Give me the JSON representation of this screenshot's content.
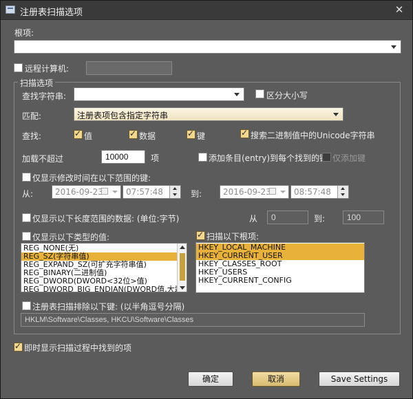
{
  "window": {
    "title": "注册表扫描选项",
    "close_glyph": "✕"
  },
  "root": {
    "label": "根项:",
    "value": ""
  },
  "remote": {
    "label": "远程计算机:",
    "checked": false,
    "value": ""
  },
  "scan_options": {
    "label": "扫描选项"
  },
  "find_string": {
    "label": "查找字符串:",
    "value": ""
  },
  "case_sensitive": {
    "label": "区分大小写",
    "checked": false
  },
  "match": {
    "label": "匹配:",
    "value": "注册表项包含指定字符串"
  },
  "search": {
    "label": "查找:",
    "values_label": "值",
    "values_checked": true,
    "data_label": "数据",
    "data_checked": true,
    "keys_label": "键",
    "keys_checked": true,
    "unicode_label": "搜索二进制值中的Unicode字符串",
    "unicode_checked": true
  },
  "load_limit": {
    "label": "加载不超过",
    "value": "10000",
    "unit": "项"
  },
  "add_entry": {
    "label": "添加条目(entry)到每个找到的键",
    "checked": false
  },
  "add_keys_only": {
    "label": "仅添加键",
    "checked": false
  },
  "modified_time": {
    "label": "仅显示修改时间在以下范围的键:",
    "checked": false,
    "from_label": "从:",
    "to_label": "到:",
    "from_date": "2016-09-23",
    "from_time": "07:57:48",
    "to_date": "2016-09-23",
    "to_time": "08:57:48"
  },
  "data_length": {
    "label": "仅显示以下长度范围的数据: (单位:字节)",
    "checked": false,
    "from_label": "从",
    "from_value": "0",
    "to_label": "到:",
    "to_value": "100"
  },
  "value_types": {
    "label": "仅显示以下类型的值:",
    "checked": false,
    "items": [
      {
        "text": "REG_NONE(无)",
        "selected": false
      },
      {
        "text": "REG_SZ(字符串值)",
        "selected": true
      },
      {
        "text": "REG_EXPAND_SZ(可扩充字符串值)",
        "selected": false
      },
      {
        "text": "REG_BINARY(二进制值)",
        "selected": false
      },
      {
        "text": "REG_DWORD(DWORD<32位>值)",
        "selected": false
      },
      {
        "text": "REG_DWORD_BIG_ENDIAN(DWORD值,大端)",
        "selected": false
      }
    ]
  },
  "root_keys": {
    "label": "扫描以下根项:",
    "checked": true,
    "items": [
      {
        "text": "HKEY_LOCAL_MACHINE",
        "selected": true
      },
      {
        "text": "HKEY_CURRENT_USER",
        "selected": true
      },
      {
        "text": "HKEY_CLASSES_ROOT",
        "selected": false
      },
      {
        "text": "HKEY_USERS",
        "selected": false
      },
      {
        "text": "HKEY_CURRENT_CONFIG",
        "selected": false
      }
    ]
  },
  "exclude": {
    "label": "注册表扫描排除以下键: (以半角逗号分隔)",
    "checked": false,
    "value": "HKLM\\Software\\Classes, HKCU\\Software\\Classes"
  },
  "show_found": {
    "label": "即时显示扫描过程中找到的项",
    "checked": true
  },
  "buttons": {
    "ok": "确定",
    "cancel": "取消",
    "save": "Save Settings"
  }
}
